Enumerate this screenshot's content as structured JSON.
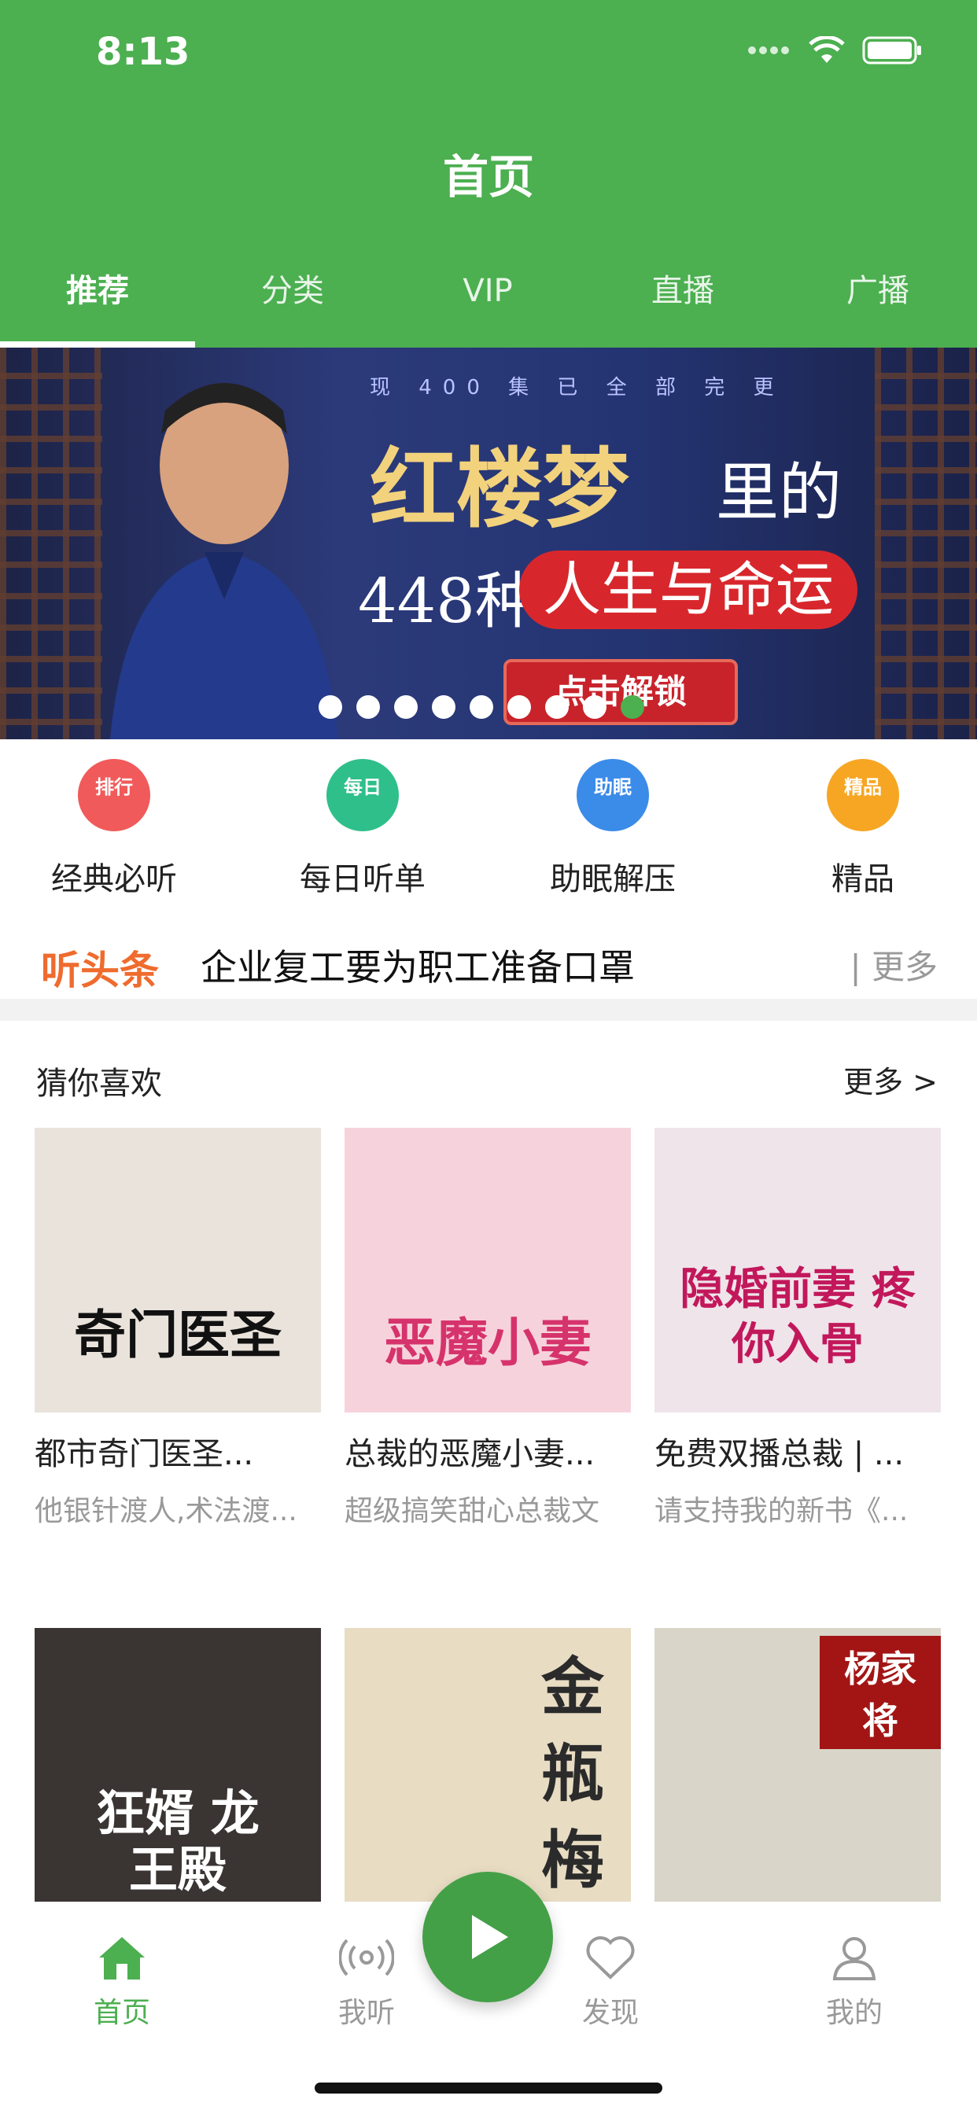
{
  "status": {
    "time": "8:13"
  },
  "header": {
    "title": "首页"
  },
  "tabs": [
    "推荐",
    "分类",
    "VIP",
    "直播",
    "广播"
  ],
  "banner": {
    "top_text": "现 400 集 已 全 部 完 更",
    "title": "红楼梦",
    "title_suffix": "里的",
    "subtitle_left": "448种",
    "subtitle_pill": "人生与命运",
    "cta": "点击解锁",
    "dot_count": 9,
    "active_dot": 8
  },
  "quick_entries": [
    {
      "badge": "排行",
      "label": "经典必听",
      "color": "#f15a5a"
    },
    {
      "badge": "每日",
      "label": "每日听单",
      "color": "#2fbf8a"
    },
    {
      "badge": "助眠",
      "label": "助眠解压",
      "color": "#3b8be8"
    },
    {
      "badge": "精品",
      "label": "精品",
      "color": "#f6a623"
    }
  ],
  "headline": {
    "brand": "听头条",
    "text": "企业复工要为职工准备口罩",
    "more": "| 更多"
  },
  "recommend": {
    "title": "猜你喜欢",
    "more": "更多 >",
    "items": [
      {
        "title": "都市奇门医圣...",
        "subtitle": "他银针渡人,术法渡...",
        "cover_text": "奇门医圣",
        "cover_bg": "#e9e3dc",
        "cover_color": "#111"
      },
      {
        "title": "总裁的恶魔小妻...",
        "subtitle": "超级搞笑甜心总裁文",
        "cover_text": "恶魔小妻",
        "cover_bg": "#f6d3dc",
        "cover_color": "#d6336c"
      },
      {
        "title": "免费双播总裁 | ...",
        "subtitle": "请支持我的新书《...",
        "cover_text": "隐婚前妻 疼你入骨",
        "cover_bg": "#efe4ea",
        "cover_color": "#c2185b"
      },
      {
        "title": "",
        "subtitle": "",
        "cover_text": "狂婿 龙王殿",
        "cover_bg": "#3a3433",
        "cover_color": "#fff"
      },
      {
        "title": "",
        "subtitle": "",
        "cover_text": "金瓶梅",
        "cover_bg": "#e8dcc3",
        "cover_color": "#2b2b2b"
      },
      {
        "title": "",
        "subtitle": "",
        "cover_text": "杨家将",
        "cover_bg": "#d9d5c9",
        "cover_color": "#a31515"
      }
    ]
  },
  "bottom_nav": [
    {
      "label": "首页",
      "icon": "home-icon",
      "active": true
    },
    {
      "label": "我听",
      "icon": "broadcast-icon",
      "active": false
    },
    {
      "label": "发现",
      "icon": "heart-icon",
      "active": false
    },
    {
      "label": "我的",
      "icon": "person-icon",
      "active": false
    }
  ]
}
